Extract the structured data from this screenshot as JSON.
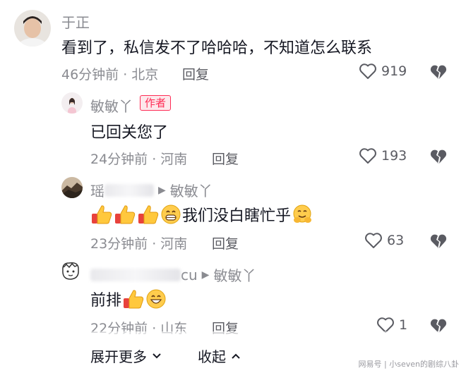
{
  "comments": [
    {
      "user": "于正",
      "text": "看到了，私信发不了哈哈哈，不知道怎么联系",
      "meta": "46分钟前 · 北京",
      "reply": "回复",
      "likes": "919"
    },
    {
      "user": "敏敏丫",
      "badge": "作者",
      "text": "已回关您了",
      "meta": "24分钟前 · 河南",
      "reply": "回复",
      "likes": "193"
    },
    {
      "user_visible": "瑶",
      "reply_to": "敏敏丫",
      "text": "我们没白瞎忙乎",
      "meta": "23分钟前 · 河南",
      "reply": "回复",
      "likes": "63"
    },
    {
      "user_visible": "cu",
      "reply_to": "敏敏丫",
      "text": "前排",
      "meta": "22分钟前 · 山东",
      "reply": "回复",
      "likes": "1"
    }
  ],
  "footer": {
    "expand": "展开更多",
    "collapse": "收起"
  },
  "watermark": "网易号 | 小seven的剧综八卦",
  "icons": {
    "like": "heart-outline-icon",
    "dislike": "broken-heart-icon"
  }
}
